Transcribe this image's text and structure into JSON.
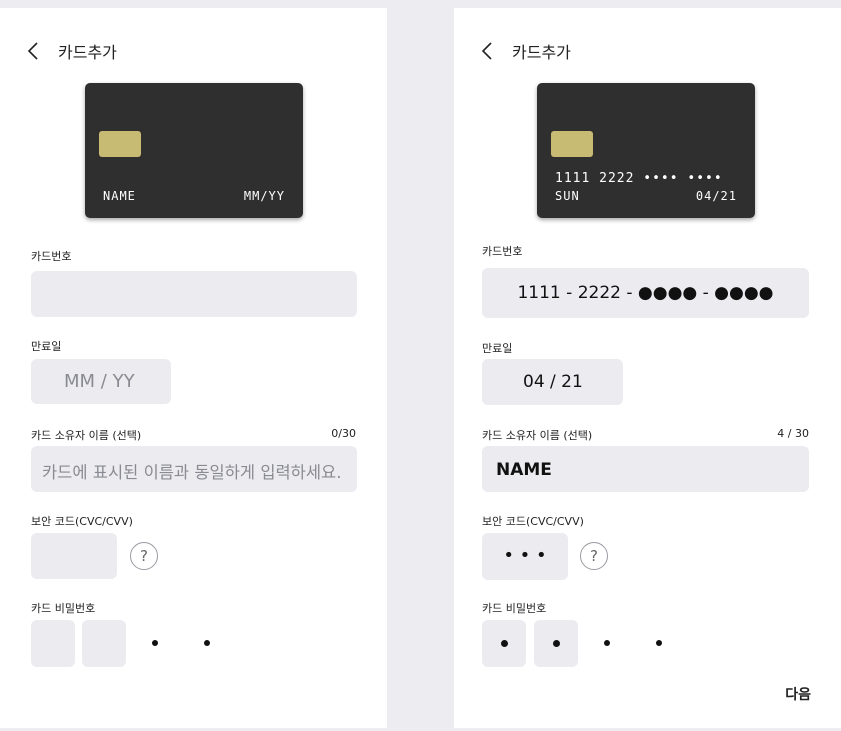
{
  "left": {
    "title": "카드추가",
    "card": {
      "name": "NAME",
      "expiry": "MM/YY"
    },
    "card_number_label": "카드번호",
    "card_number_value": "",
    "expiry_label": "만료일",
    "expiry_placeholder": "MM / YY",
    "owner_label": "카드 소유자 이름 (선택)",
    "owner_counter": "0/30",
    "owner_placeholder": "카드에 표시된 이름과 동일하게 입력하세요.",
    "cvc_label": "보안 코드(CVC/CVV)",
    "cvc_help": "?",
    "password_label": "카드 비밀번호",
    "password_dots": "•",
    "password_filled_count": 0,
    "password_total_digits": 2
  },
  "right": {
    "title": "카드추가",
    "card": {
      "number": "1111 2222 •••• ••••",
      "name": "SUN",
      "expiry": "04/21"
    },
    "card_number_label": "카드번호",
    "card_number_value": "1111 - 2222 - ●●●● - ●●●●",
    "expiry_label": "만료일",
    "expiry_value": "04 / 21",
    "owner_label": "카드 소유자 이름 (선택)",
    "owner_counter": "4 / 30",
    "owner_value": "NAME",
    "cvc_label": "보안 코드(CVC/CVV)",
    "cvc_value": "• • •",
    "cvc_help": "?",
    "password_label": "카드 비밀번호",
    "password_filled_count": 2,
    "next_label": "다음"
  },
  "colors": {
    "background": "#ededf1",
    "card": "#2f2f2f",
    "chip": "#c7bb73",
    "field": "#ebebf0"
  }
}
